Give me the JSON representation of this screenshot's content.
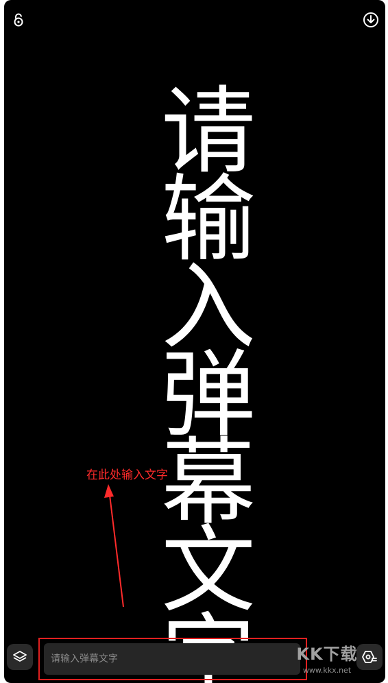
{
  "danmu": {
    "text": "请输入弹幕文字",
    "color": "#ffffff",
    "background": "#000000"
  },
  "annotation": {
    "text": "在此处输入文字",
    "color": "#ff2b2b"
  },
  "input": {
    "placeholder": "请输入弹幕文字",
    "value": ""
  },
  "icons": {
    "lock": "unlock-icon",
    "download": "download-icon",
    "layers": "layers-icon",
    "settings": "settings-icon"
  },
  "watermark": {
    "logo": "KK下载",
    "url": "www.kkx.net"
  }
}
